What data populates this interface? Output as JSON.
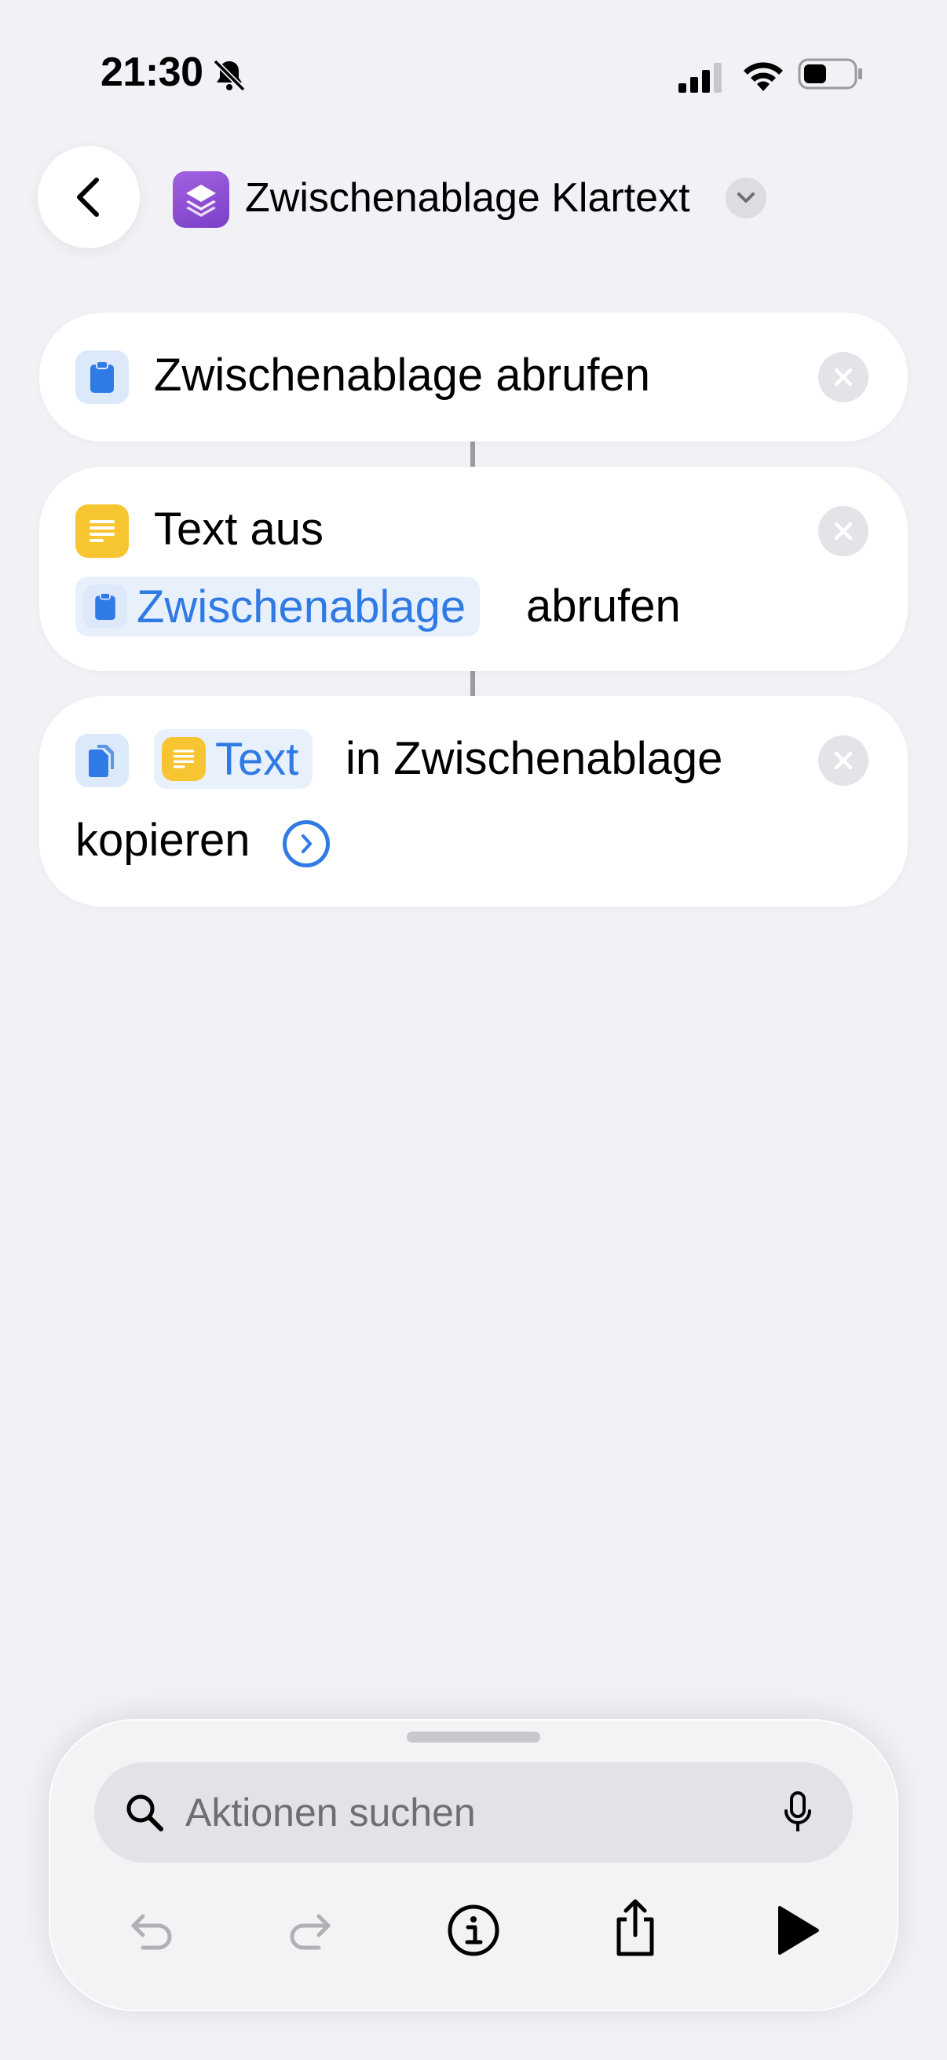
{
  "status_bar": {
    "time": "21:30",
    "icons": [
      "bell-slash-icon",
      "cellular-signal-icon",
      "wifi-icon",
      "battery-icon"
    ]
  },
  "header": {
    "back_icon": "chevron-left-icon",
    "app_icon": "shortcuts-stack-icon",
    "title": "Zwischenablage Klartext",
    "title_menu_icon": "chevron-down-icon",
    "app_color": "#8e4fd6"
  },
  "actions": [
    {
      "icon": "clipboard-icon",
      "text": "Zwischenablage abrufen",
      "remove_icon": "xmark-icon"
    },
    {
      "icon": "text-lines-icon",
      "text_before": "Text aus",
      "token": "Zwischenablage",
      "token_icon": "clipboard-icon",
      "text_after": "abrufen",
      "remove_icon": "xmark-icon"
    },
    {
      "icon": "copy-documents-icon",
      "token": "Text",
      "token_icon": "text-lines-icon",
      "text_after": "in Zwischenablage",
      "text_line2": "kopieren",
      "more_icon": "chevron-right-circle-icon",
      "remove_icon": "xmark-icon"
    }
  ],
  "toolbar": {
    "search_placeholder": "Aktionen suchen",
    "search_icon": "magnifying-glass-icon",
    "mic_icon": "microphone-icon",
    "buttons": [
      "undo-icon",
      "redo-icon",
      "info-icon",
      "share-icon",
      "play-icon"
    ]
  },
  "colors": {
    "accent": "#2f7ae5",
    "text_yellow": "#f7c531",
    "background": "#f1f1f6"
  }
}
